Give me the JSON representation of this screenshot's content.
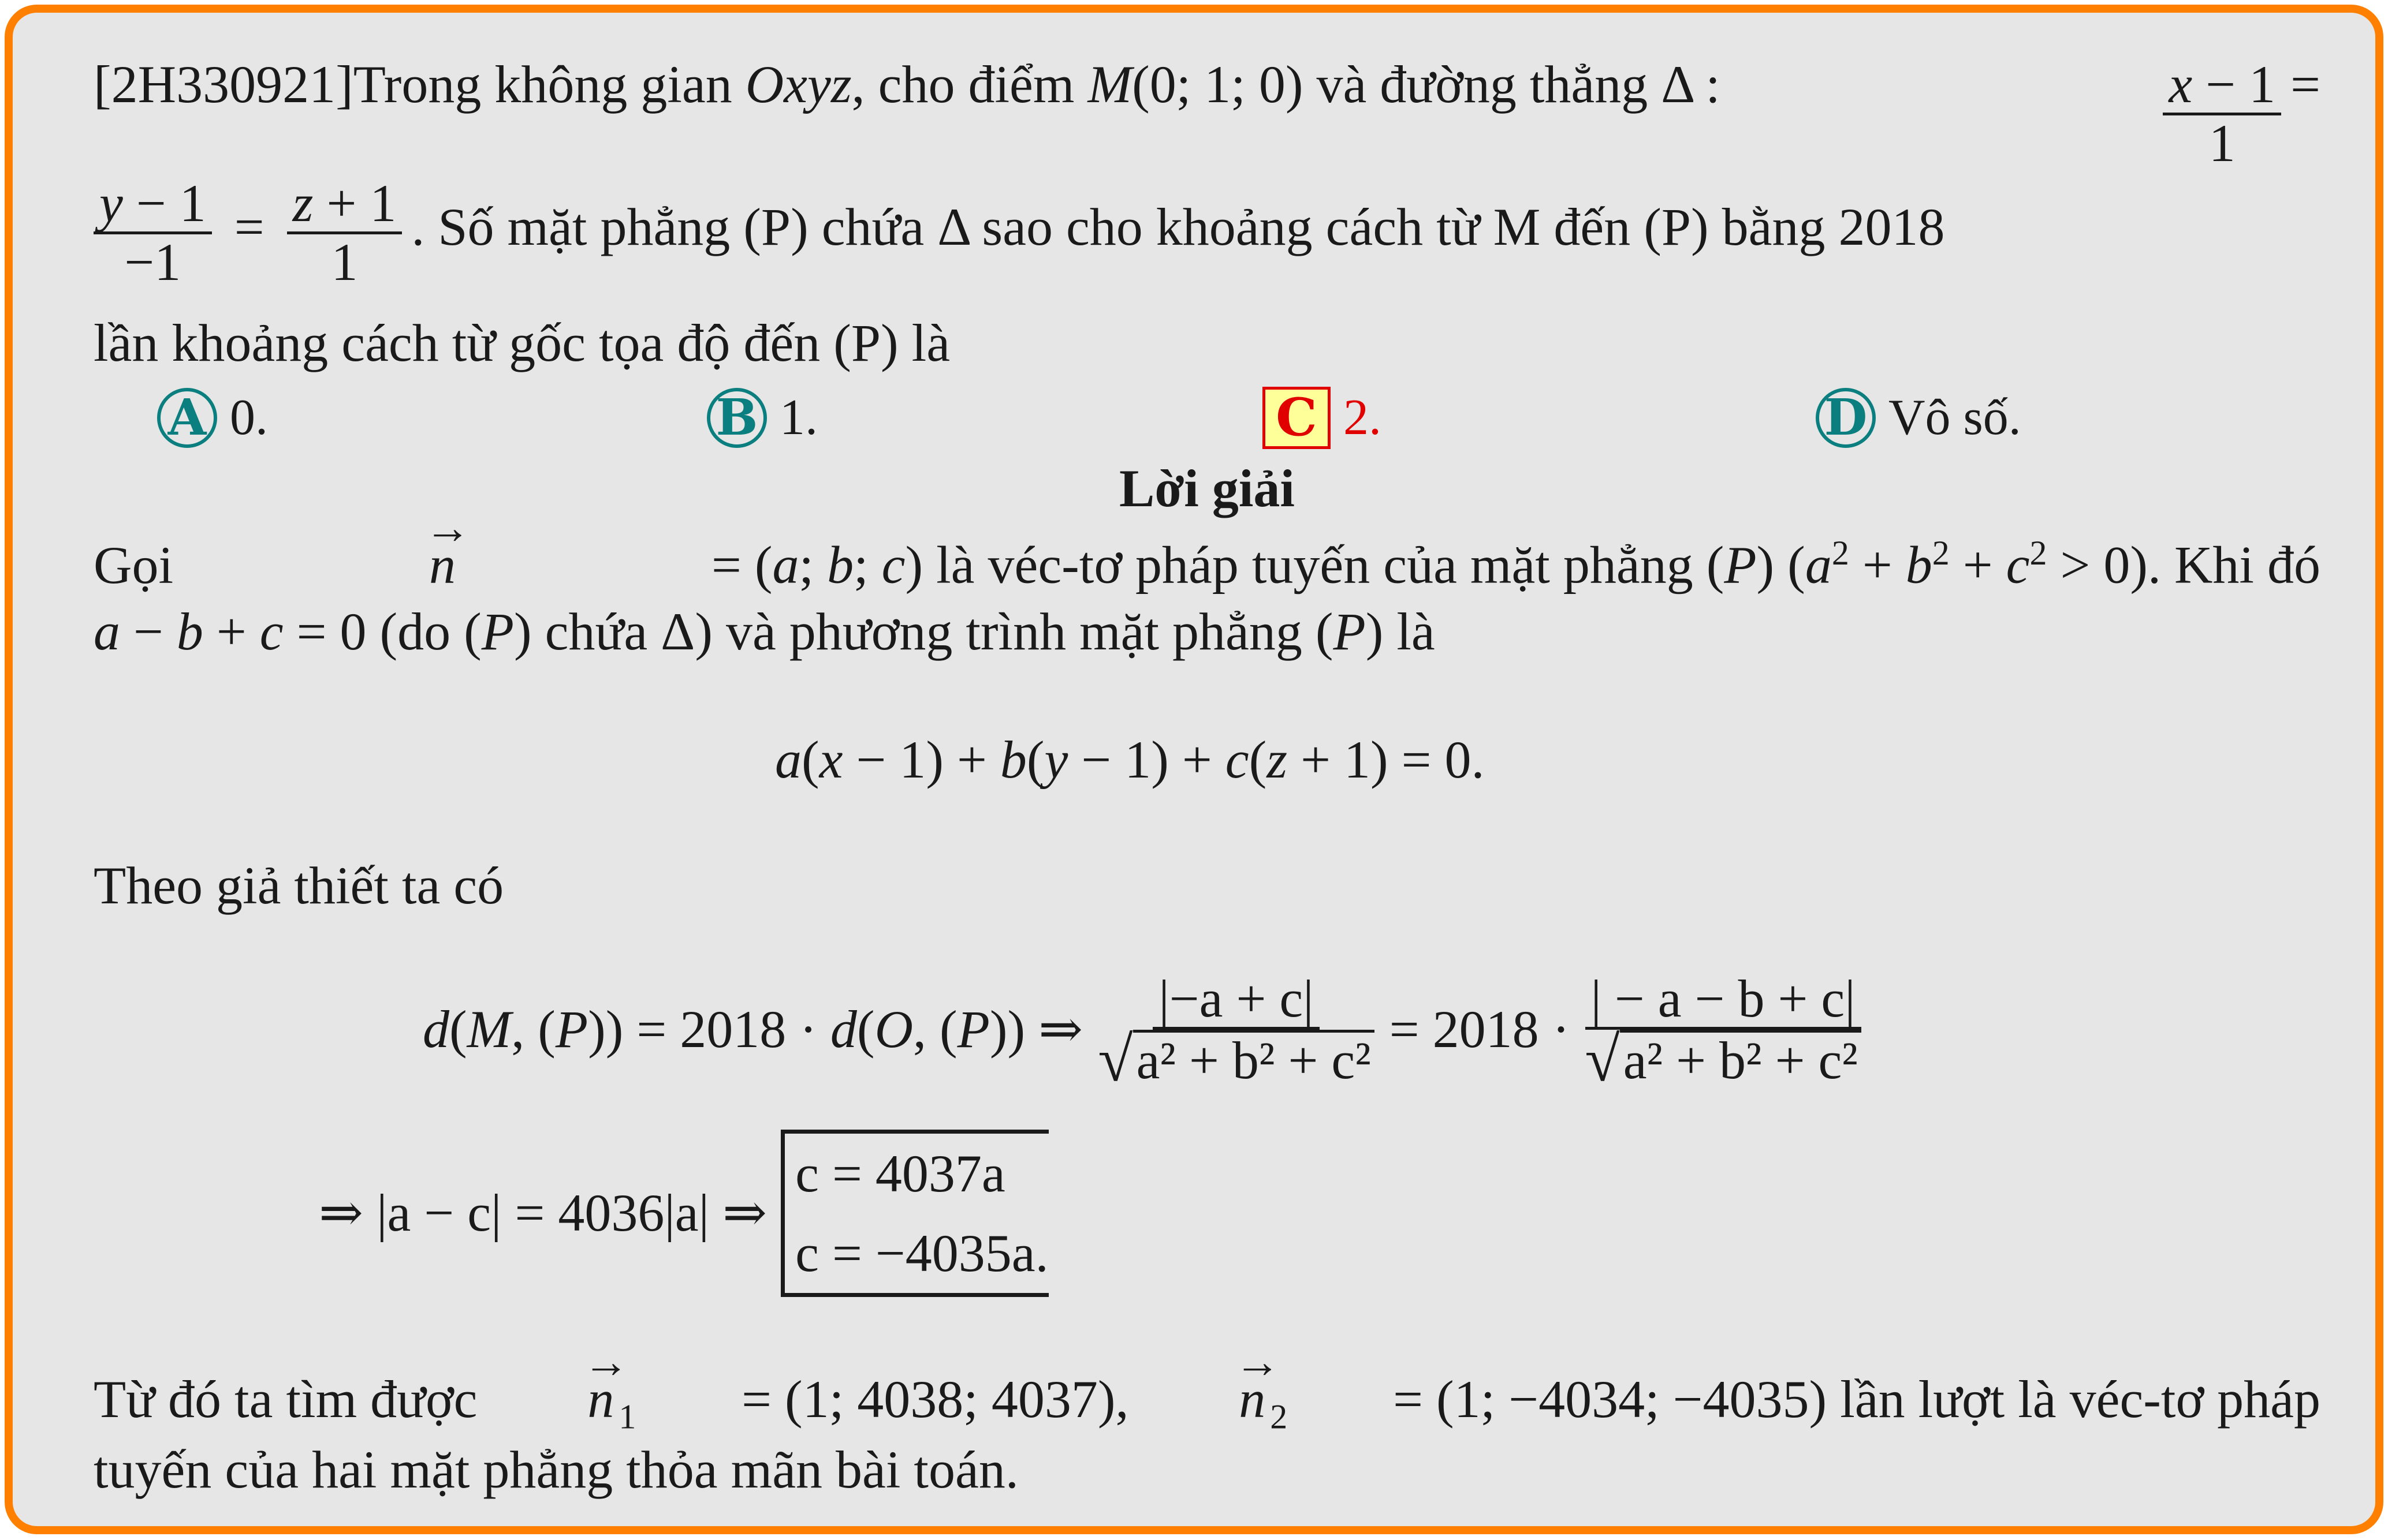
{
  "question": {
    "code": "[2H330921]",
    "line1_text": "Trong không gian Oxyz, cho điểm M(0; 1; 0) và đường thẳng Δ :",
    "line2_text": ". Số mặt phẳng (P) chứa Δ sao cho khoảng cách từ M đến (P) bằng 2018",
    "line3_text": "lần khoảng cách từ gốc tọa độ đến (P) là"
  },
  "options": [
    {
      "letter": "A",
      "text": "0.",
      "correct": false
    },
    {
      "letter": "B",
      "text": "1.",
      "correct": false
    },
    {
      "letter": "C",
      "text": "2.",
      "correct": true
    },
    {
      "letter": "D",
      "text": "Vô số.",
      "correct": false
    }
  ],
  "solution": {
    "heading": "Lời giải",
    "p1_line1_start": "Gọi",
    "p1_line1_mid": "= (a; b; c) là véc-tơ pháp tuyến của mặt phẳng (P) (a² + b² + c² > 0). Khi đó",
    "p1_line2": "a − b + c = 0 (do (P) chứa Δ) và phương trình mặt phẳng (P) là",
    "eq1": "a(x − 1) + b(y − 1) + c(z + 1) = 0.",
    "p2": "Theo giả thiết ta có",
    "eq2_left": "d(M, (P)) = 2018 · d(O, (P)) ⇒",
    "eq2_num1": "|−a + c|",
    "eq2_mid": "= 2018 ·",
    "eq2_num2": "| − a − b + c|",
    "eq2_den": "a² + b² + c²",
    "eq3_left": "⇒  |a − c| = 4036|a| ⇒",
    "eq3_case1": "c = 4037a",
    "eq3_case2": "c = −4035a.",
    "p3_line1_start": "Từ đó ta tìm được",
    "p3_n1": "= (1; 4038; 4037),",
    "p3_n2": "= (1; −4034; −4035) lần lượt là véc-tơ pháp",
    "p3_line2": "tuyến của hai mặt phẳng thỏa mãn bài toán."
  },
  "colors": {
    "border": "#ff8000",
    "background": "#e6e6e6",
    "option_circle": "#0b7f7f",
    "correct": "#e00000",
    "correct_fill": "#ffff99"
  }
}
